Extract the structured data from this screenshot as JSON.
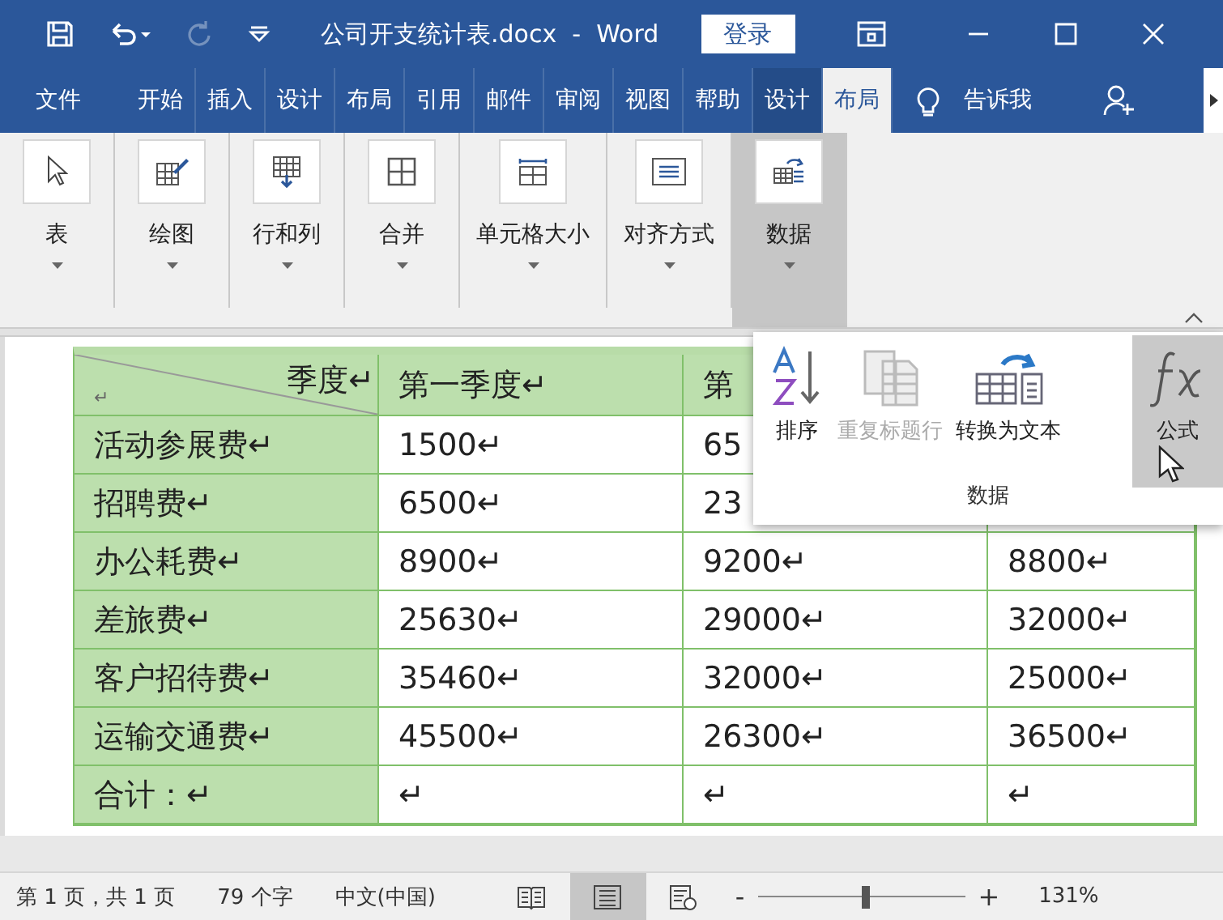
{
  "window": {
    "title": "公司开支统计表.docx  -  Word",
    "login_button": "登录",
    "redo_disabled": true
  },
  "tabs": [
    {
      "label": "文件",
      "selected": false,
      "kind": "file"
    },
    {
      "label": "开始",
      "selected": false,
      "kind": "main"
    },
    {
      "label": "插入",
      "selected": false,
      "kind": "main"
    },
    {
      "label": "设计",
      "selected": false,
      "kind": "main"
    },
    {
      "label": "布局",
      "selected": false,
      "kind": "main"
    },
    {
      "label": "引用",
      "selected": false,
      "kind": "main"
    },
    {
      "label": "邮件",
      "selected": false,
      "kind": "main"
    },
    {
      "label": "审阅",
      "selected": false,
      "kind": "main"
    },
    {
      "label": "视图",
      "selected": false,
      "kind": "main"
    },
    {
      "label": "帮助",
      "selected": false,
      "kind": "main"
    },
    {
      "label": "设计",
      "selected": false,
      "kind": "context"
    },
    {
      "label": "布局",
      "selected": true,
      "kind": "context"
    }
  ],
  "tell_me": "告诉我",
  "ribbon": {
    "groups": [
      {
        "label": "表",
        "kind": "select",
        "expanded": false
      },
      {
        "label": "绘图",
        "kind": "draw",
        "expanded": false
      },
      {
        "label": "行和列",
        "kind": "rows",
        "expanded": false
      },
      {
        "label": "合并",
        "kind": "merge",
        "expanded": false
      },
      {
        "label": "单元格大小",
        "kind": "size",
        "expanded": false
      },
      {
        "label": "对齐方式",
        "kind": "align",
        "expanded": false
      },
      {
        "label": "数据",
        "kind": "data",
        "expanded": true
      }
    ]
  },
  "data_panel": {
    "title": "数据",
    "items": [
      {
        "label": "排序",
        "kind": "sort",
        "disabled": false,
        "selected": false
      },
      {
        "label": "重复标题行",
        "kind": "repeat",
        "disabled": true,
        "selected": false
      },
      {
        "label": "转换为文本",
        "kind": "convert",
        "disabled": false,
        "selected": false
      },
      {
        "label": "公式",
        "kind": "formula",
        "disabled": false,
        "selected": true
      }
    ]
  },
  "table": {
    "corner": {
      "left": "↵",
      "right": "季度↵"
    },
    "header": [
      "第一季度↵",
      "第"
    ],
    "rows": [
      {
        "label": "活动参展费↵",
        "cells": [
          "1500↵",
          "65"
        ]
      },
      {
        "label": "招聘费↵",
        "cells": [
          "6500↵",
          "23"
        ]
      },
      {
        "label": "办公耗费↵",
        "cells": [
          "8900↵",
          "9200↵",
          "8800↵"
        ]
      },
      {
        "label": "差旅费↵",
        "cells": [
          "25630↵",
          "29000↵",
          "32000↵"
        ]
      },
      {
        "label": "客户招待费↵",
        "cells": [
          "35460↵",
          "32000↵",
          "25000↵"
        ]
      },
      {
        "label": "运输交通费↵",
        "cells": [
          "45500↵",
          "26300↵",
          "36500↵"
        ]
      },
      {
        "label": "合计：↵",
        "cells": [
          "↵",
          "↵",
          "↵"
        ]
      }
    ]
  },
  "status_bar": {
    "page": "第 1 页，共 1 页",
    "words": "79 个字",
    "language": "中文(中国)",
    "views": [
      {
        "kind": "read",
        "selected": false
      },
      {
        "kind": "print",
        "selected": true
      },
      {
        "kind": "web",
        "selected": false
      }
    ],
    "zoom_minus": "-",
    "zoom_slider": {
      "level": 0.52
    },
    "zoom_plus": "+",
    "zoom": "131%"
  }
}
